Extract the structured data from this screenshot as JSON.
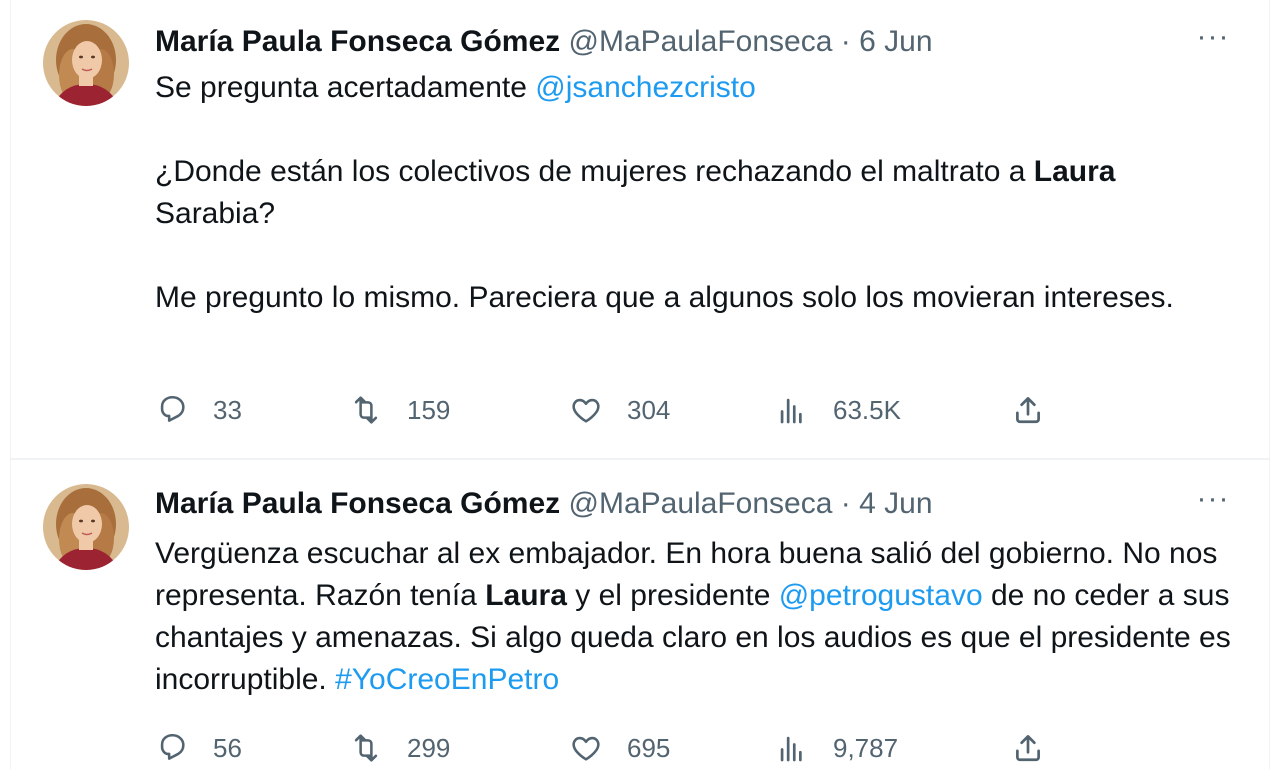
{
  "tweets": [
    {
      "name": "María Paula Fonseca Gómez",
      "handle": "@MaPaulaFonseca",
      "dot": "·",
      "date": "6 Jun",
      "more": "···",
      "body": {
        "p1_text": "Se pregunta acertadamente ",
        "p1_mention": "@jsanchezcristo",
        "p2_text": "¿Donde están los colectivos de mujeres rechazando el maltrato a ",
        "p2_bold": "Laura",
        "p2_text2": " Sarabia?",
        "p3_text": "Me pregunto lo mismo. Pareciera que a algunos solo los movieran intereses."
      },
      "stats": {
        "replies": "33",
        "retweets": "159",
        "likes": "304",
        "views": "63.5K"
      }
    },
    {
      "name": "María Paula Fonseca Gómez",
      "handle": "@MaPaulaFonseca",
      "dot": "·",
      "date": "4 Jun",
      "more": "···",
      "body": {
        "text1": "Vergüenza escuchar al ex embajador. En hora buena salió del gobierno. No nos representa. Razón tenía ",
        "bold": "Laura",
        "text2": " y el presidente ",
        "mention": "@petrogustavo",
        "text3": " de no ceder a sus chantajes y amenazas. Si algo queda claro en los audios es que el presidente es incorruptible. ",
        "hashtag": "#YoCreoEnPetro"
      },
      "stats": {
        "replies": "56",
        "retweets": "299",
        "likes": "695",
        "views": "9,787"
      }
    }
  ],
  "colors": {
    "link": "#1d9bf0",
    "secondary": "#536471",
    "text": "#0f1419",
    "divider": "#eff3f4"
  },
  "icons": [
    "reply-icon",
    "retweet-icon",
    "like-icon",
    "views-icon",
    "share-icon",
    "more-icon"
  ]
}
